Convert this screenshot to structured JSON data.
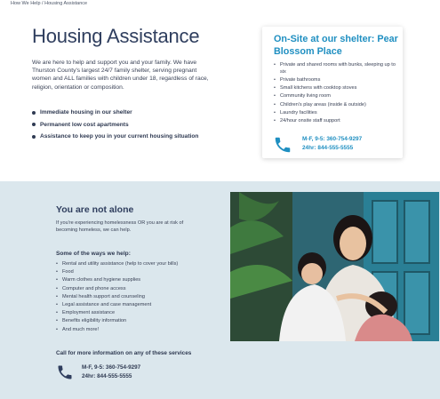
{
  "breadcrumb": "How We Help / Housing Assistance",
  "hero": {
    "title": "Housing Assistance",
    "intro": "We are here to help and support you and your family. We have Thurston County's largest 24/7 family shelter, serving pregnant women and ALL families with children under 18, regardless of race, religion, orientation or composition.",
    "bullets": [
      "Immediate housing in our shelter",
      "Permanent low cost apartments",
      "Assistance to keep you in your current housing situation"
    ]
  },
  "card": {
    "title": "On-Site at our shelter: Pear Blossom Place",
    "items": [
      "Private and shared rooms with bunks, sleeping up to six",
      "Private bathrooms",
      "Small kitchens with cooktop stoves",
      "Community living room",
      "Children's play areas (inside & outside)",
      "Laundry facilities",
      "24/hour onsite staff support"
    ],
    "phone_weekday": "M-F, 9-5: 360-754-9297",
    "phone_24hr": "24hr: 844-555-5555"
  },
  "section": {
    "title": "You are not alone",
    "intro": "If you're experiencing homelessness OR you are at risk of becoming homeless, we can help.",
    "ways_title": "Some of the ways we help:",
    "ways": [
      "Rental and utility assistance (help to cover your bills)",
      "Food",
      "Warm clothes and hygiene supplies",
      "Computer and phone access",
      "Mental health support and counseling",
      "Legal assistance and case management",
      "Employment assistance",
      "Benefits eligibility information",
      "And much more!"
    ],
    "call_title": "Call for more information on any of these services",
    "phone_weekday": "M-F, 9-5: 360-754-9297",
    "phone_24hr": "24hr: 844-555-5555"
  },
  "colors": {
    "accent": "#1f8fc1",
    "navy": "#2f3e5e",
    "section_bg": "#dbe7ed"
  },
  "icons": {
    "card_phone": "phone-icon",
    "section_phone": "phone-icon",
    "photo": "family-photo"
  }
}
